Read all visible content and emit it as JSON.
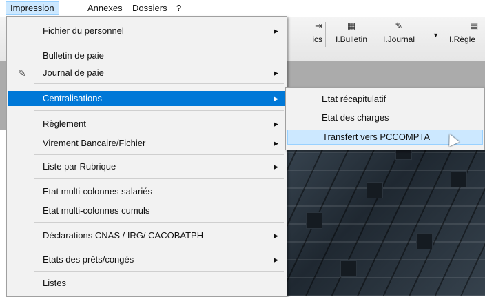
{
  "menubar": {
    "items": [
      {
        "label": "Impression",
        "open": true
      },
      {
        "label": "Annexes"
      },
      {
        "label": "Dossiers"
      },
      {
        "label": "?"
      }
    ]
  },
  "toolbar": {
    "partial_label": "ics",
    "items": [
      {
        "label": "I.Bulletin",
        "icon": "bulletin-icon"
      },
      {
        "label": "I.Journal",
        "icon": "journal-icon"
      },
      {
        "label": "I.Règle",
        "icon": "regle-icon"
      }
    ]
  },
  "menu": {
    "items": [
      {
        "label": "Fichier du personnel",
        "submenu": true
      },
      {
        "label": "Bulletin de paie",
        "submenu": false
      },
      {
        "label": "Journal de paie",
        "submenu": true,
        "icon": "journal-icon"
      },
      {
        "label": "Centralisations",
        "submenu": true,
        "highlighted": true
      },
      {
        "label": "Règlement",
        "submenu": true
      },
      {
        "label": "Virement Bancaire/Fichier",
        "submenu": true
      },
      {
        "label": "Liste par Rubrique",
        "submenu": true
      },
      {
        "label": "Etat multi-colonnes salariés",
        "submenu": false
      },
      {
        "label": "Etat multi-colonnes  cumuls",
        "submenu": false
      },
      {
        "label": "Déclarations CNAS / IRG/  CACOBATPH",
        "submenu": true
      },
      {
        "label": "Etats des prêts/congés",
        "submenu": true
      },
      {
        "label": "Listes",
        "submenu": false
      }
    ]
  },
  "submenu": {
    "items": [
      {
        "label": "Etat récapitulatif"
      },
      {
        "label": "Etat des charges"
      },
      {
        "label": "Transfert vers PCCOMPTA",
        "hovered": true
      }
    ]
  },
  "colors": {
    "highlight": "#0078d7",
    "hover": "#cce8ff",
    "menu_bg": "#f2f2f2"
  }
}
